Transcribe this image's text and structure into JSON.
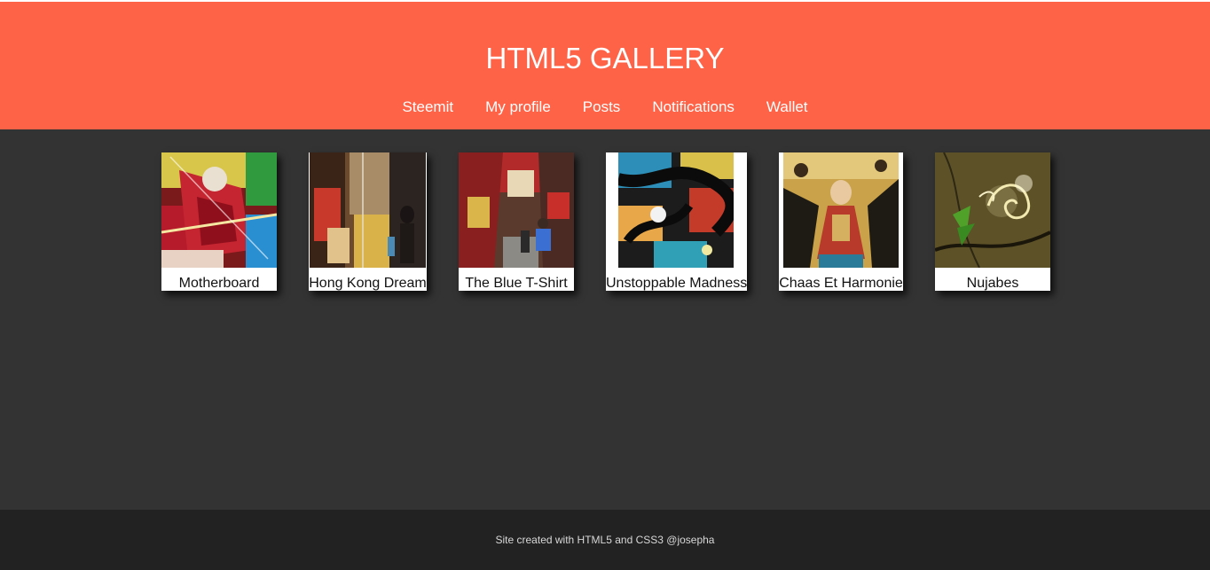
{
  "header": {
    "title": "HTML5 GALLERY",
    "background": "#ff6347",
    "nav": [
      {
        "label": "Steemit"
      },
      {
        "label": "My profile"
      },
      {
        "label": "Posts"
      },
      {
        "label": "Notifications"
      },
      {
        "label": "Wallet"
      }
    ]
  },
  "gallery": {
    "background": "#333333",
    "items": [
      {
        "caption": "Motherboard"
      },
      {
        "caption": "Hong Kong Dream"
      },
      {
        "caption": "The Blue T-Shirt"
      },
      {
        "caption": "Unstoppable Madness"
      },
      {
        "caption": "Chaas Et Harmonie"
      },
      {
        "caption": "Nujabes"
      }
    ]
  },
  "footer": {
    "text": "Site created with HTML5 and CSS3 @josepha"
  }
}
